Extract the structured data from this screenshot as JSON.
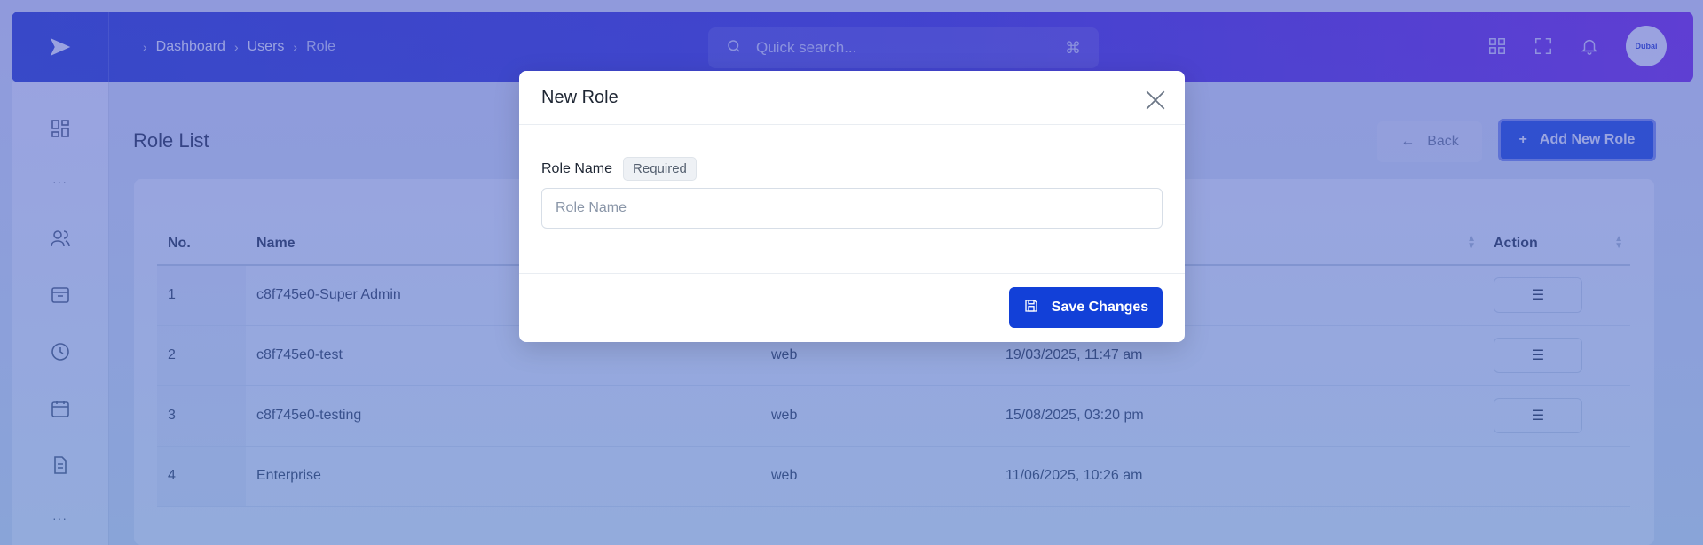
{
  "header": {
    "breadcrumb": [
      "Dashboard",
      "Users",
      "Role"
    ],
    "search_placeholder": "Quick search...",
    "search_shortcut": "⌘",
    "avatar_text": "Dubai"
  },
  "sidebar": {
    "items": [
      "dashboard-icon",
      "more",
      "users-icon",
      "inbox-icon",
      "clock-icon",
      "calendar-icon",
      "document-icon",
      "more"
    ]
  },
  "page": {
    "title": "Role List",
    "back_label": "Back",
    "add_label": "Add New Role"
  },
  "table": {
    "columns": [
      "No.",
      "Name",
      "",
      "",
      "Action"
    ],
    "rows": [
      {
        "no": "1",
        "name": "c8f745e0-Super Admin",
        "guard": "",
        "date": ""
      },
      {
        "no": "2",
        "name": "c8f745e0-test",
        "guard": "web",
        "date": "19/03/2025, 11:47 am"
      },
      {
        "no": "3",
        "name": "c8f745e0-testing",
        "guard": "web",
        "date": "15/08/2025, 03:20 pm"
      },
      {
        "no": "4",
        "name": "Enterprise",
        "guard": "web",
        "date": "11/06/2025, 10:26 am"
      }
    ]
  },
  "modal": {
    "title": "New Role",
    "field_label": "Role Name",
    "required_badge": "Required",
    "input_placeholder": "Role Name",
    "input_value": "",
    "save_label": "Save Changes"
  },
  "colors": {
    "primary": "#1240d8",
    "overlay": "#4658c8"
  }
}
